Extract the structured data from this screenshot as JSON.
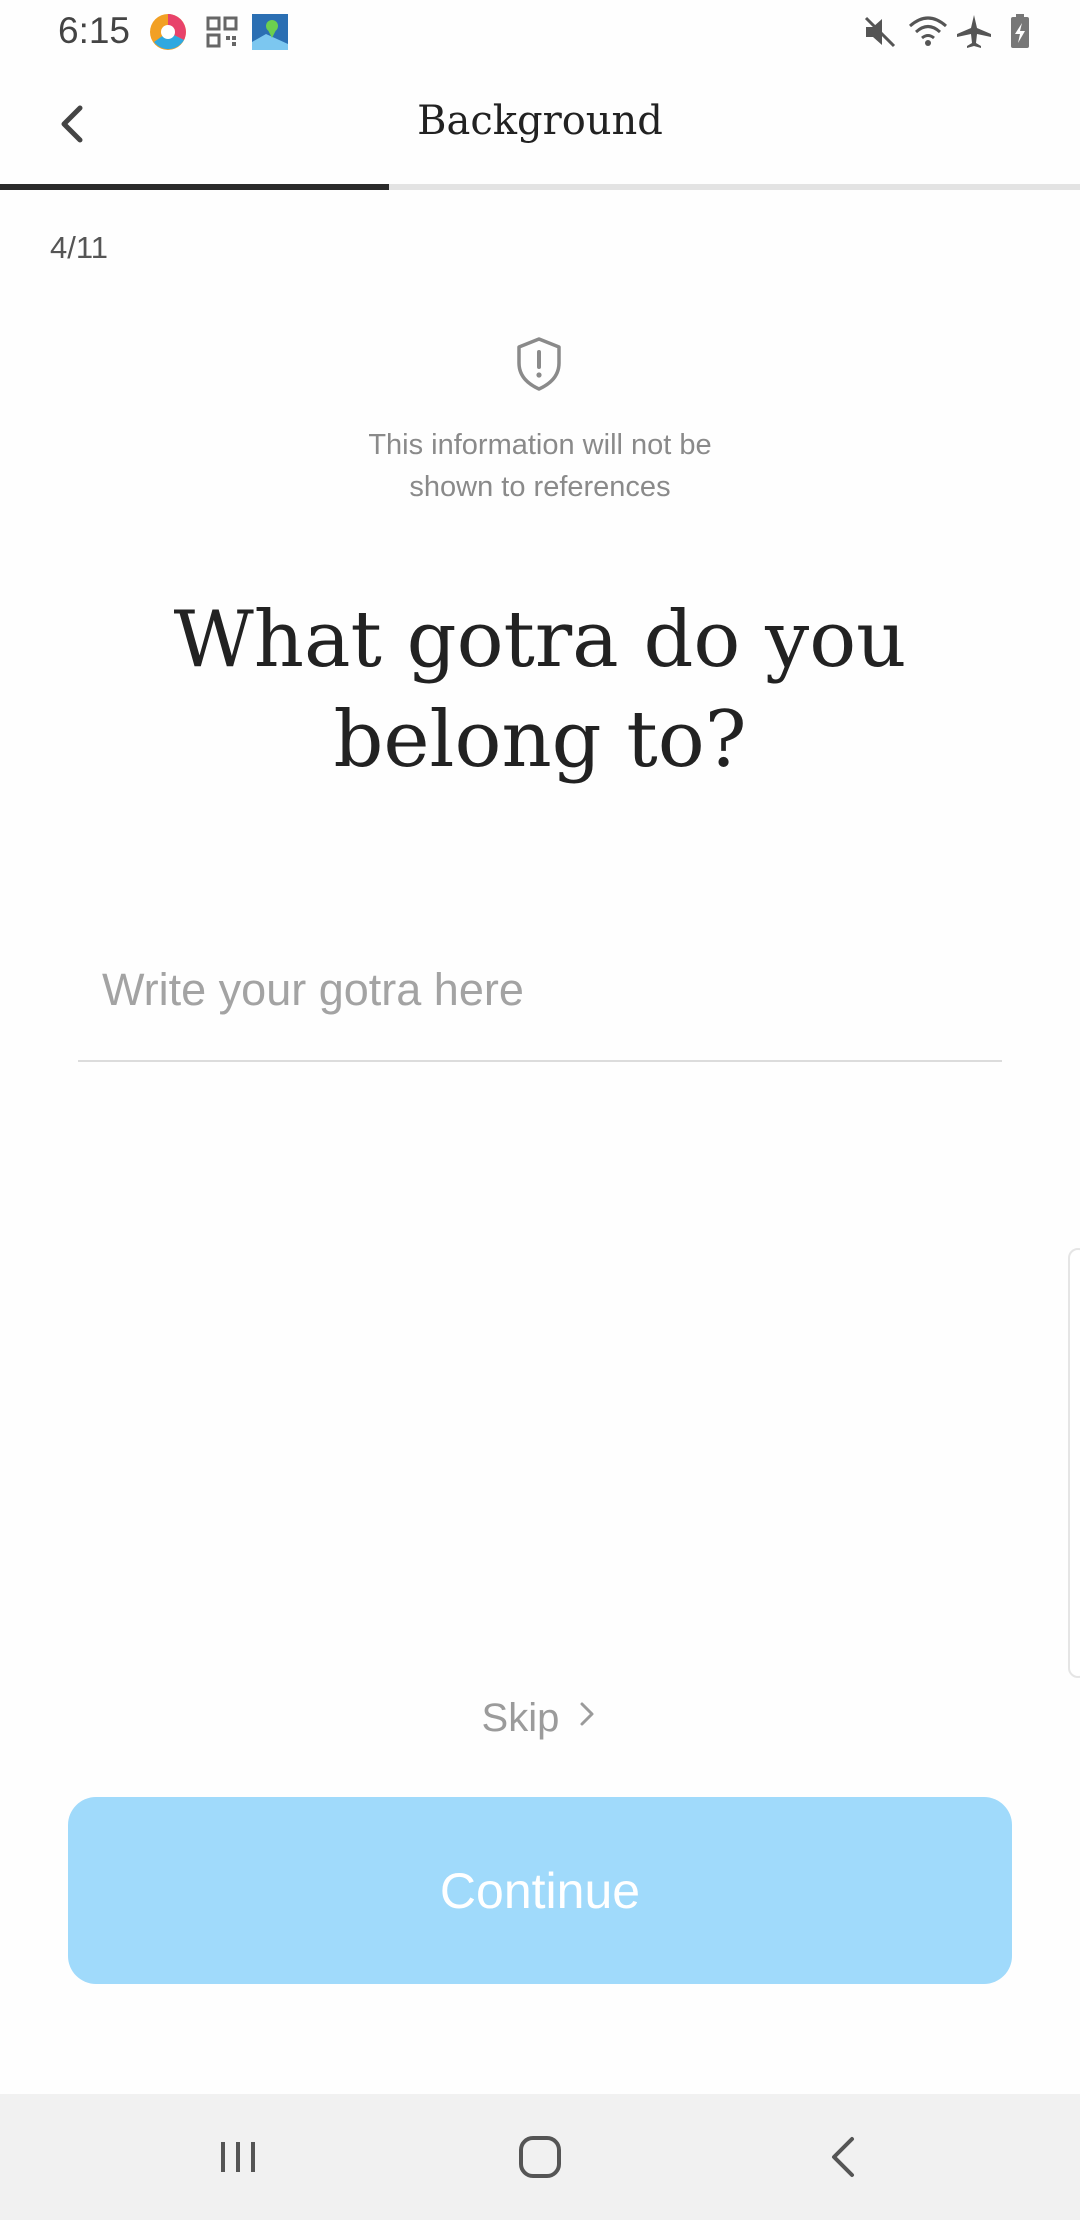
{
  "status_bar": {
    "time": "6:15",
    "icons_left": [
      "chrome-like-app-icon",
      "qr-code-icon",
      "photos-map-icon"
    ],
    "icons_right": [
      "muted-icon",
      "wifi-icon",
      "airplane-mode-icon",
      "battery-icon"
    ]
  },
  "header": {
    "title": "Background",
    "back_icon": "chevron-left-icon",
    "progress": 0.36
  },
  "step": {
    "counter": "4/11"
  },
  "privacy": {
    "icon": "shield-alert-icon",
    "line1": "This information will not be",
    "line2": "shown to references"
  },
  "question": {
    "line1": "What gotra do you",
    "line2": "belong to?"
  },
  "input": {
    "placeholder": "Write your gotra here",
    "value": ""
  },
  "actions": {
    "skip_label": "Skip",
    "continue_label": "Continue",
    "continue_color": "#a0dafb"
  },
  "nav_bar": {
    "buttons": [
      "recent-apps-icon",
      "home-icon",
      "back-icon"
    ]
  }
}
